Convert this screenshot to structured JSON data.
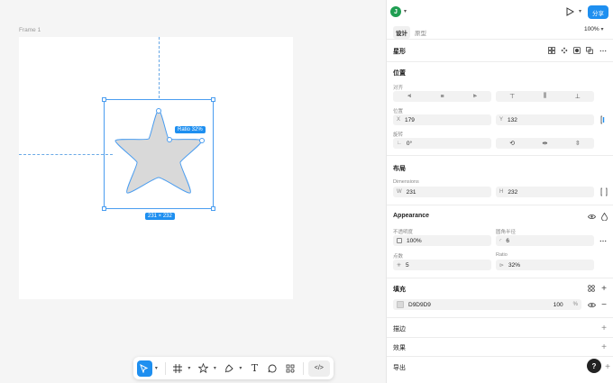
{
  "canvas": {
    "frame_label": "Frame 1",
    "ratio_badge": "Ratio 32%",
    "dimension_badge": "231 × 232",
    "star_fill": "#D9D9D9",
    "selection_color": "#4A9DF0"
  },
  "toolbar": {
    "tools": [
      "move-tool",
      "frame-tool",
      "shape-tool",
      "pen-tool",
      "text-tool",
      "comment-tool",
      "actions-tool",
      "dev-mode-toggle"
    ],
    "text_glyph": "T",
    "code_glyph": "</>"
  },
  "header": {
    "avatar_initial": "J",
    "share_label": "分享",
    "tab_design": "设计",
    "tab_prototype": "原型",
    "zoom": "100%"
  },
  "layer": {
    "name": "星形"
  },
  "position": {
    "title": "位置",
    "align_label": "对齐",
    "position_label": "位置",
    "x_prefix": "X",
    "x_value": "179",
    "y_prefix": "Y",
    "y_value": "132",
    "rotation_label": "旋转",
    "rotation_value": "0°"
  },
  "layout": {
    "title": "布局",
    "dimensions_label": "Dimensions",
    "w_prefix": "W",
    "w_value": "231",
    "h_prefix": "H",
    "h_value": "232"
  },
  "appearance": {
    "title": "Appearance",
    "opacity_label": "不透明度",
    "opacity_value": "100%",
    "radius_label": "圆角半径",
    "radius_value": "6",
    "count_label": "点数",
    "count_value": "5",
    "ratio_label": "Ratio",
    "ratio_value": "32%"
  },
  "fill": {
    "title": "填充",
    "hex": "D9D9D9",
    "opacity": "100",
    "percent": "%"
  },
  "stroke": {
    "title": "描边"
  },
  "effects": {
    "title": "效果"
  },
  "export": {
    "title": "导出"
  },
  "help": {
    "label": "?"
  }
}
